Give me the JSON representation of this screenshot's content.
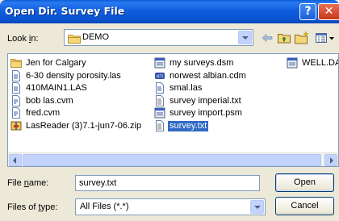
{
  "window": {
    "title": "Open Dir. Survey File",
    "help_glyph": "?",
    "close_glyph": "✕"
  },
  "lookin": {
    "label_prefix": "Look ",
    "label_mnemonic": "i",
    "label_suffix": "n:",
    "value": "DEMO"
  },
  "files": [
    {
      "name": "Jen for Calgary",
      "icon": "folder-icon"
    },
    {
      "name": "6-30 density porosity.las",
      "icon": "las-file-icon"
    },
    {
      "name": "410MAIN1.LAS",
      "icon": "las-file-icon"
    },
    {
      "name": "bob las.cvm",
      "icon": "cvm-file-icon"
    },
    {
      "name": "fred.cvm",
      "icon": "cvm-file-icon"
    },
    {
      "name": "LasReader (3)7.1-jun7-06.zip",
      "icon": "zip-file-icon"
    },
    {
      "name": "my surveys.dsm",
      "icon": "dsm-file-icon"
    },
    {
      "name": "norwest albian.cdm",
      "icon": "cdm-file-icon"
    },
    {
      "name": "smal.las",
      "icon": "las-file-icon"
    },
    {
      "name": "survey imperial.txt",
      "icon": "text-file-icon"
    },
    {
      "name": "survey import.psm",
      "icon": "psm-file-icon"
    },
    {
      "name": "survey.txt",
      "icon": "text-file-icon",
      "selected": true
    },
    {
      "name": "WELL.DAT",
      "icon": "dat-file-icon"
    }
  ],
  "filename": {
    "label_prefix": "File ",
    "label_mnemonic": "n",
    "label_suffix": "ame:",
    "value": "survey.txt"
  },
  "filetype": {
    "label_prefix": "Files of ",
    "label_mnemonic": "t",
    "label_suffix": "ype:",
    "value": "All Files (*.*)"
  },
  "buttons": {
    "open_label": "Open",
    "cancel_label": "Cancel"
  },
  "colors": {
    "titlebar": "#0b55d2",
    "selection": "#316ac5",
    "dialog_bg": "#ece9d8"
  }
}
